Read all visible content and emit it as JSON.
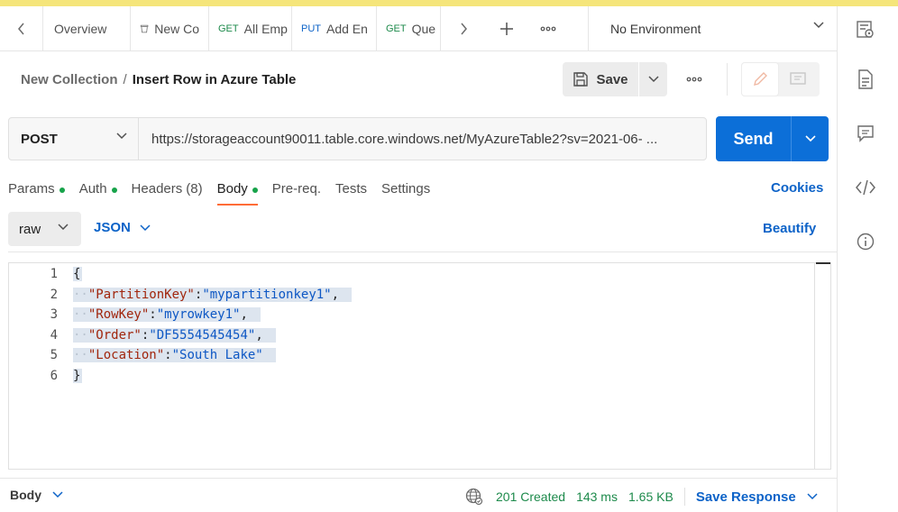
{
  "tabs": [
    {
      "method": "",
      "label": "Overview"
    },
    {
      "method": "",
      "label": "New Co"
    },
    {
      "method": "GET",
      "label": "All Emp"
    },
    {
      "method": "PUT",
      "label": "Add En"
    },
    {
      "method": "GET",
      "label": "Que"
    }
  ],
  "environment": {
    "label": "No Environment"
  },
  "breadcrumb": {
    "parent": "New Collection",
    "separator": "/",
    "current": "Insert Row in Azure Table"
  },
  "toolbar": {
    "save_label": "Save"
  },
  "request": {
    "method": "POST",
    "url": "https://storageaccount90011.table.core.windows.net/MyAzureTable2?sv=2021-06- ...",
    "send_label": "Send"
  },
  "request_tabs": [
    {
      "label": "Params",
      "dot": true,
      "count": ""
    },
    {
      "label": "Auth",
      "dot": true,
      "count": ""
    },
    {
      "label": "Headers",
      "dot": false,
      "count": "(8)"
    },
    {
      "label": "Body",
      "dot": true,
      "count": ""
    },
    {
      "label": "Pre-req.",
      "dot": false,
      "count": ""
    },
    {
      "label": "Tests",
      "dot": false,
      "count": ""
    },
    {
      "label": "Settings",
      "dot": false,
      "count": ""
    }
  ],
  "cookies_label": "Cookies",
  "body_toolbar": {
    "mode": "raw",
    "format": "JSON",
    "beautify_label": "Beautify"
  },
  "editor": {
    "line_numbers": [
      "1",
      "2",
      "3",
      "4",
      "5",
      "6"
    ],
    "lines": [
      {
        "open": "{"
      },
      {
        "key": "\"PartitionKey\"",
        "value": "\"mypartitionkey1\"",
        "trail": ","
      },
      {
        "key": "\"RowKey\"",
        "value": "\"myrowkey1\"",
        "trail": ","
      },
      {
        "key": "\"Order\"",
        "value": "\"DF5554545454\"",
        "trail": ","
      },
      {
        "key": "\"Location\"",
        "value": "\"South Lake\"",
        "trail": ""
      },
      {
        "close": "}"
      }
    ]
  },
  "response": {
    "tab_label": "Body",
    "status": "201 Created",
    "time": "143 ms",
    "size": "1.65 KB",
    "save_label": "Save Response"
  },
  "colors": {
    "accent": "#0c6fd8",
    "active_tab": "#ff6c37",
    "status_ok": "#1d8a4b"
  }
}
